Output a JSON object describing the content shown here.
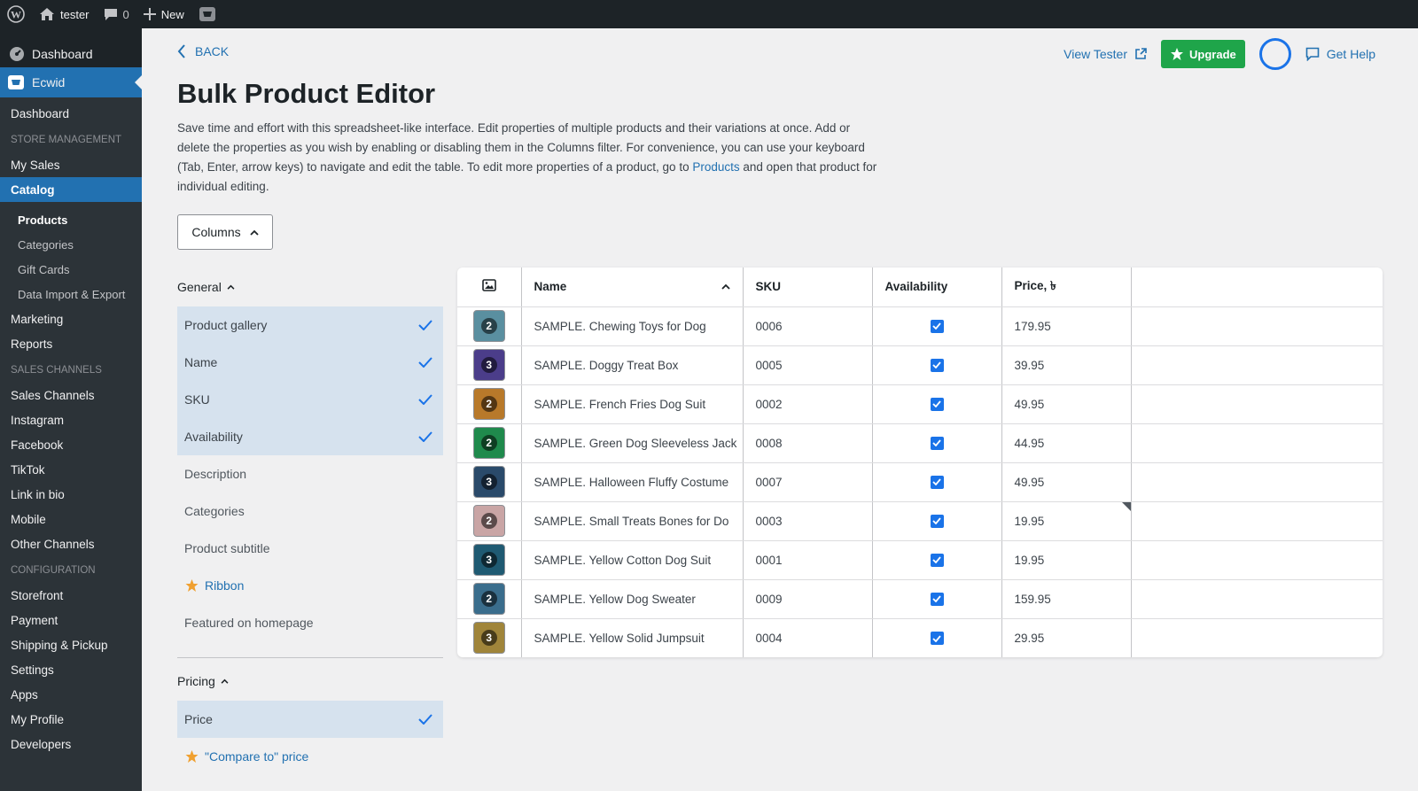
{
  "adminbar": {
    "site_name": "tester",
    "comments_count": "0",
    "new_label": "New"
  },
  "sidebar": {
    "dashboard": "Dashboard",
    "ecwid": "Ecwid",
    "items": [
      {
        "type": "item",
        "label": "Dashboard"
      },
      {
        "type": "head",
        "label": "STORE MANAGEMENT"
      },
      {
        "type": "item",
        "label": "My Sales"
      },
      {
        "type": "active",
        "label": "Catalog"
      },
      {
        "type": "child-current",
        "label": "Products"
      },
      {
        "type": "child",
        "label": "Categories"
      },
      {
        "type": "child",
        "label": "Gift Cards"
      },
      {
        "type": "child",
        "label": "Data Import & Export"
      },
      {
        "type": "item",
        "label": "Marketing"
      },
      {
        "type": "item",
        "label": "Reports"
      },
      {
        "type": "head",
        "label": "SALES CHANNELS"
      },
      {
        "type": "item",
        "label": "Sales Channels"
      },
      {
        "type": "item",
        "label": "Instagram"
      },
      {
        "type": "item",
        "label": "Facebook"
      },
      {
        "type": "item",
        "label": "TikTok"
      },
      {
        "type": "item",
        "label": "Link in bio"
      },
      {
        "type": "item",
        "label": "Mobile"
      },
      {
        "type": "item",
        "label": "Other Channels"
      },
      {
        "type": "head",
        "label": "CONFIGURATION"
      },
      {
        "type": "item",
        "label": "Storefront"
      },
      {
        "type": "item",
        "label": "Payment"
      },
      {
        "type": "item",
        "label": "Shipping & Pickup"
      },
      {
        "type": "item",
        "label": "Settings"
      },
      {
        "type": "item",
        "label": "Apps"
      },
      {
        "type": "item",
        "label": "My Profile"
      },
      {
        "type": "item",
        "label": "Developers"
      }
    ]
  },
  "header": {
    "back_label": "BACK",
    "view_label": "View Tester",
    "upgrade_label": "Upgrade",
    "help_label": "Get Help"
  },
  "page": {
    "title": "Bulk Product Editor",
    "intro_before": "Save time and effort with this spreadsheet-like interface. Edit properties of multiple products and their variations at once. Add or delete the properties as you wish by enabling or disabling them in the Columns filter. For convenience, you can use your keyboard (Tab, Enter, arrow keys) to navigate and edit the table. To edit more properties of a product, go to ",
    "intro_link": "Products",
    "intro_after": " and open that product for individual editing.",
    "columns_button": "Columns"
  },
  "filters": {
    "general_title": "General",
    "general_options": [
      {
        "label": "Product gallery",
        "checked": true,
        "star": false
      },
      {
        "label": "Name",
        "checked": true,
        "star": false
      },
      {
        "label": "SKU",
        "checked": true,
        "star": false
      },
      {
        "label": "Availability",
        "checked": true,
        "star": false
      },
      {
        "label": "Description",
        "checked": false,
        "star": false
      },
      {
        "label": "Categories",
        "checked": false,
        "star": false
      },
      {
        "label": "Product subtitle",
        "checked": false,
        "star": false
      },
      {
        "label": "Ribbon",
        "checked": false,
        "star": true
      },
      {
        "label": "Featured on homepage",
        "checked": false,
        "star": false
      }
    ],
    "pricing_title": "Pricing",
    "pricing_options": [
      {
        "label": "Price",
        "checked": true,
        "star": false
      },
      {
        "label": "\"Compare to\" price",
        "checked": false,
        "star": true
      }
    ]
  },
  "table": {
    "headers": {
      "name": "Name",
      "sku": "SKU",
      "availability": "Availability",
      "price": "Price, ৳"
    },
    "rows": [
      {
        "badge": "2",
        "color": "#5a8fa0",
        "name": "SAMPLE. Chewing Toys for Dog",
        "sku": "0006",
        "available": true,
        "price": "179.95"
      },
      {
        "badge": "3",
        "color": "#4b3d8a",
        "name": "SAMPLE. Doggy Treat Box",
        "sku": "0005",
        "available": true,
        "price": "39.95"
      },
      {
        "badge": "2",
        "color": "#b8792a",
        "name": "SAMPLE. French Fries Dog Suit",
        "sku": "0002",
        "available": true,
        "price": "49.95"
      },
      {
        "badge": "2",
        "color": "#1f8a4c",
        "name": "SAMPLE. Green Dog Sleeveless Jack",
        "sku": "0008",
        "available": true,
        "price": "44.95"
      },
      {
        "badge": "3",
        "color": "#2a4a6a",
        "name": "SAMPLE. Halloween Fluffy Costume",
        "sku": "0007",
        "available": true,
        "price": "49.95"
      },
      {
        "badge": "2",
        "color": "#c9a5a5",
        "name": "SAMPLE. Small Treats Bones for Do",
        "sku": "0003",
        "available": true,
        "price": "19.95"
      },
      {
        "badge": "3",
        "color": "#1f5a72",
        "name": "SAMPLE. Yellow Cotton Dog Suit",
        "sku": "0001",
        "available": true,
        "price": "19.95"
      },
      {
        "badge": "2",
        "color": "#3a6d8c",
        "name": "SAMPLE. Yellow Dog Sweater",
        "sku": "0009",
        "available": true,
        "price": "159.95"
      },
      {
        "badge": "3",
        "color": "#a0853a",
        "name": "SAMPLE. Yellow Solid Jumpsuit",
        "sku": "0004",
        "available": true,
        "price": "29.95"
      }
    ]
  }
}
